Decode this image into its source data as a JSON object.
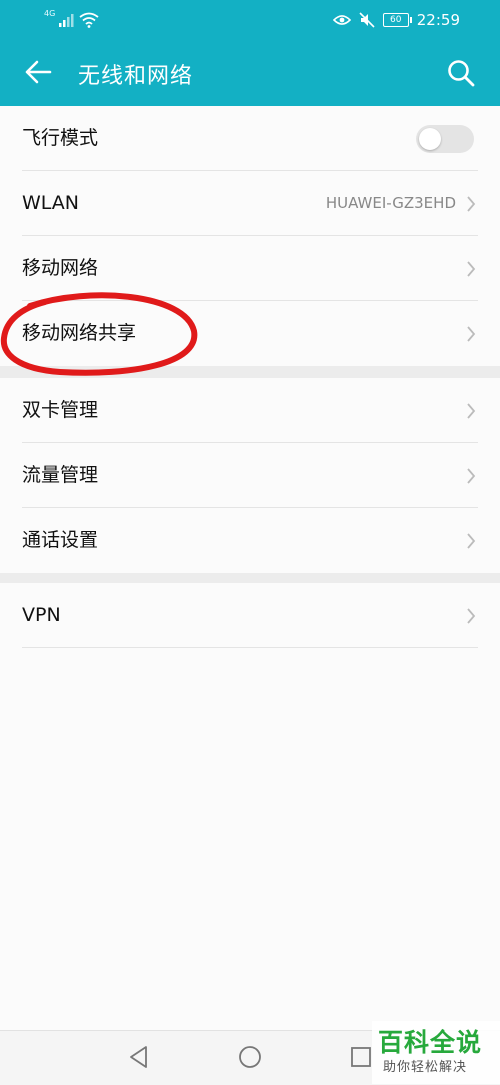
{
  "status_bar": {
    "network_type": "4G",
    "battery": "60",
    "time": "22:59"
  },
  "header": {
    "title": "无线和网络"
  },
  "settings": {
    "airplane_mode": {
      "label": "飞行模式",
      "enabled": false
    },
    "wlan": {
      "label": "WLAN",
      "value": "HUAWEI-GZ3EHD"
    },
    "mobile_network": {
      "label": "移动网络"
    },
    "tethering": {
      "label": "移动网络共享"
    },
    "dual_sim": {
      "label": "双卡管理"
    },
    "data_usage": {
      "label": "流量管理"
    },
    "call_settings": {
      "label": "通话设置"
    },
    "vpn": {
      "label": "VPN"
    }
  },
  "watermark": {
    "title": "百科全说",
    "subtitle": "助你轻松解决"
  },
  "colors": {
    "accent": "#13b0c4",
    "annotation": "#e01a1a",
    "watermark": "#27a93c"
  }
}
